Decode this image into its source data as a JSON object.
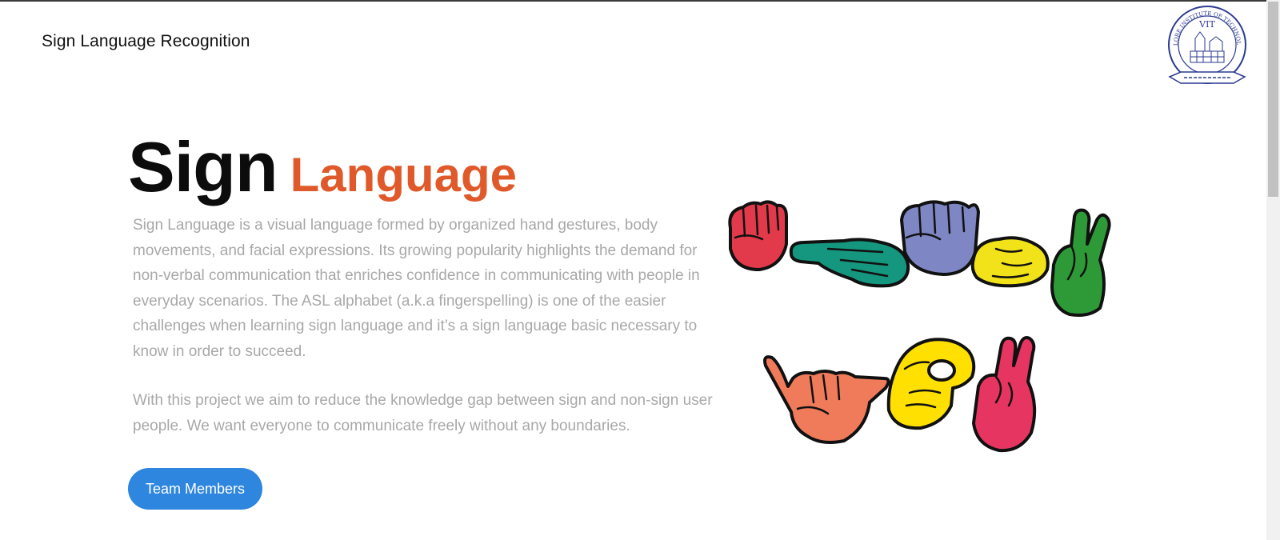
{
  "header": {
    "brand": "Sign Language Recognition",
    "logo_text": "VIT",
    "logo_ring_text": "VELLORE INSTITUTE OF TECHNOLOGY"
  },
  "hero": {
    "title_main": "Sign",
    "title_accent": "Language",
    "paragraph_1": "Sign Language is a visual language formed by organized hand gestures, body movements, and facial expressions. Its growing popularity highlights the demand for non-verbal communication that enriches confidence in communicating with people in everyday scenarios. The ASL alphabet (a.k.a fingerspelling) is one of the easier challenges when learning sign language and it’s a sign language basic necessary to know in order to succeed.",
    "paragraph_2": "With this project we aim to reduce the knowledge gap between sign and non-sign user people. We want everyone to communicate freely without any boundaries.",
    "button_label": "Team Members"
  },
  "colors": {
    "accent": "#e0592a",
    "button": "#2e86de",
    "body_text": "#a8a8a8",
    "hand_red": "#e23a4a",
    "hand_teal": "#15967f",
    "hand_blue": "#7e86c4",
    "hand_yellow": "#f1e21a",
    "hand_green": "#2e9a37",
    "hand_salmon": "#ef7b5b",
    "hand_yellow_2": "#ffe000",
    "hand_pink": "#e63560"
  },
  "illustration": {
    "icons": [
      "fist-hand-icon",
      "pointing-hand-icon",
      "fist-hand-icon",
      "curled-hand-icon",
      "peace-hand-icon",
      "shaka-hand-icon",
      "ok-hand-icon",
      "two-finger-hand-icon"
    ]
  }
}
